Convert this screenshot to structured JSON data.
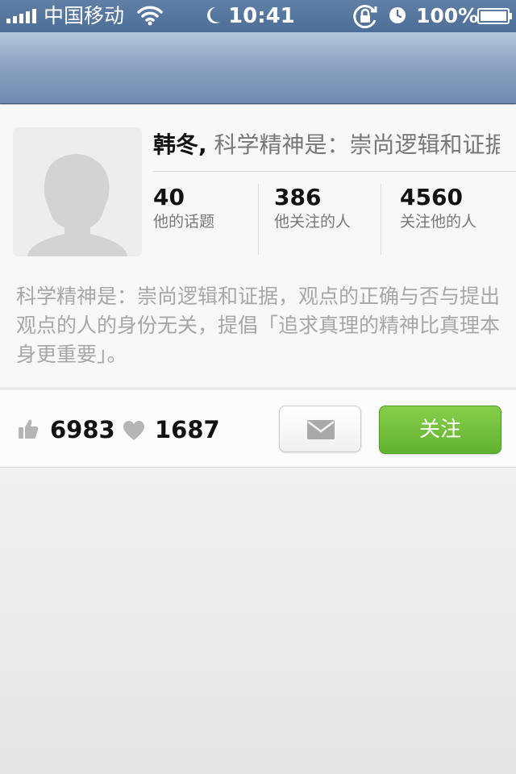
{
  "status_bar": {
    "carrier": "中国移动",
    "time": "10:41",
    "battery": "100%",
    "icons": [
      "signal-icon",
      "wifi-icon",
      "moon-icon",
      "rotation-lock-icon",
      "alarm-icon",
      "battery-icon"
    ]
  },
  "profile": {
    "name": "韩冬,",
    "motto_preview": "科学精神是：崇尚逻辑和证据",
    "avatar_icon": "avatar-placeholder-icon",
    "stats": [
      {
        "value": "40",
        "label": "他的话题"
      },
      {
        "value": "386",
        "label": "他关注的人"
      },
      {
        "value": "4560",
        "label": "关注他的人"
      }
    ],
    "bio": "科学精神是：崇尚逻辑和证据，观点的正确与否与提出观点的人的身份无关，提倡「追求真理的精神比真理本身更重要」。"
  },
  "actions": {
    "likes": "6983",
    "favorites": "1687",
    "message_icon": "envelope-icon",
    "follow_label": "关注"
  },
  "colors": {
    "status_bar": "#5a7aa2",
    "nav_bar_top": "#b6c7db",
    "nav_bar_bottom": "#7089ad",
    "follow_button": "#6cbb35",
    "bio_text": "#a7a7a7"
  }
}
